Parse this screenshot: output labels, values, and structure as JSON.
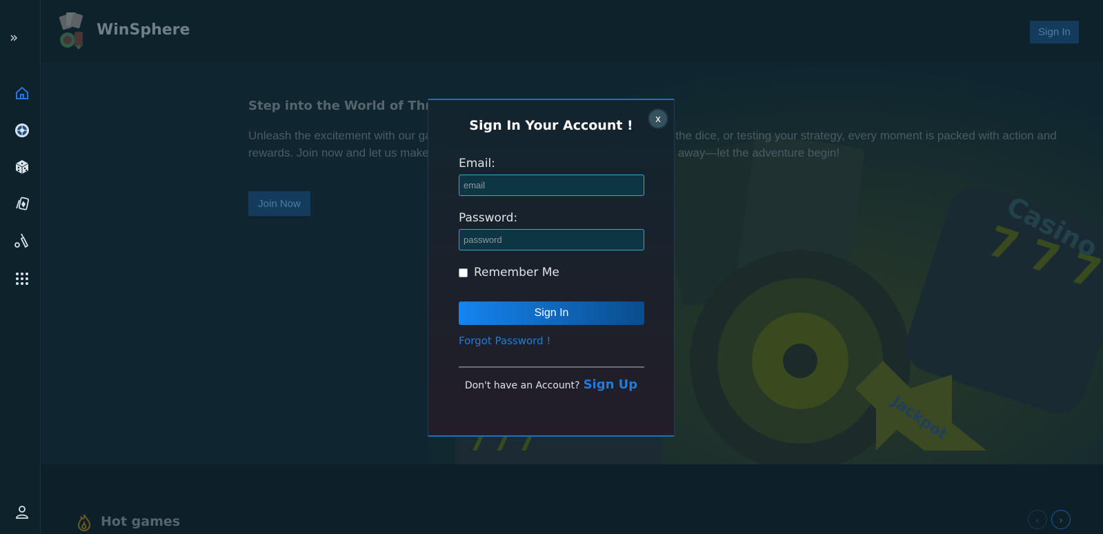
{
  "brand": {
    "name": "WinSphere"
  },
  "header": {
    "signin_label": "Sign In"
  },
  "sidebar": {
    "expand_icon": "double-chevron-right-icon",
    "items": [
      {
        "icon": "home-icon",
        "active": true
      },
      {
        "icon": "roulette-icon"
      },
      {
        "icon": "dice-icon"
      },
      {
        "icon": "cards-icon"
      },
      {
        "icon": "cricket-icon"
      },
      {
        "icon": "grid-icon"
      }
    ],
    "profile_icon": "user-icon"
  },
  "hero": {
    "title": "Step into the World of Thrills",
    "text": "Unleash the excitement with our games. Whether you're spinning the reels, rolling the dice, or testing your strategy, every moment is packed with action and rewards. Join now and let us make your luck shine. Your next big win is just a click away—let the adventure begin!",
    "join_label": "Join Now"
  },
  "hot_games": {
    "title": "Hot games",
    "prev": "‹",
    "next": "›"
  },
  "modal": {
    "title": "Sign In Your Account !",
    "close_label": "x",
    "email_label": "Email:",
    "email_placeholder": "email",
    "email_value": "",
    "password_label": "Password:",
    "password_placeholder": "password",
    "password_value": "",
    "remember_label": "Remember Me",
    "remember_checked": false,
    "submit_label": "Sign In",
    "forgot_label": "Forgot Password !",
    "signup_question": "Don't have an Account?",
    "signup_label": "Sign Up"
  },
  "colors": {
    "accent": "#1b7de0",
    "background": "#0d2029",
    "modal_border": "#1a6fc9"
  }
}
